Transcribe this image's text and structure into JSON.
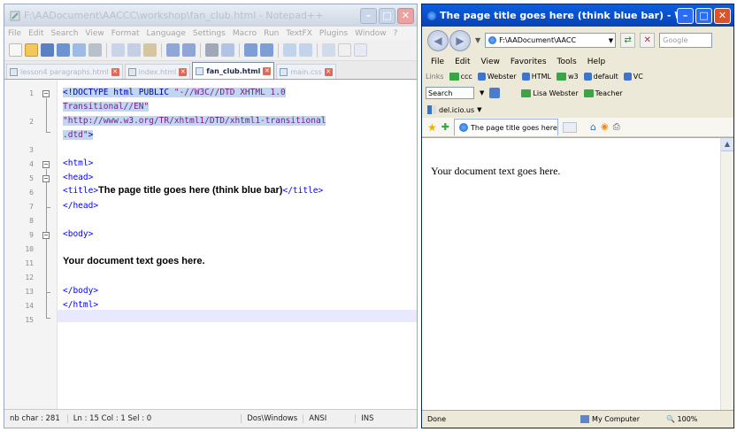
{
  "notepad": {
    "title": "F:\\AADocument\\AACCC\\workshop\\fan_club.html - Notepad++",
    "menu": [
      "File",
      "Edit",
      "Search",
      "View",
      "Format",
      "Language",
      "Settings",
      "Macro",
      "Run",
      "TextFX",
      "Plugins",
      "Window",
      "?"
    ],
    "tabs": [
      "lesson4 paragraphs.html",
      "index.html",
      "fan_club.html",
      "main.css"
    ],
    "active_tab": 2,
    "line_numbers": [
      "1",
      "2",
      "3",
      "4",
      "5",
      "6",
      "7",
      "8",
      "9",
      "10",
      "11",
      "12",
      "13",
      "14",
      "15"
    ],
    "code": {
      "l1a": "<!DOCTYPE html PUBLIC ",
      "l1b": "\"-//W3C//DTD XHTML 1.0",
      "l1c": "Transitional//EN\"",
      "l2a": "\"http://www.w3.org/TR/xhtml1/DTD/xhtml1-transitional",
      "l2b": ".dtd\"",
      "l2c": ">",
      "html_open": "<html>",
      "head_open": "<head>",
      "title_open": "<title>",
      "title_text": "The page title goes here (think blue bar)",
      "title_close": "</title>",
      "head_close": "</head>",
      "body_open": "<body>",
      "body_text": "Your document text goes here.",
      "body_close": "</body>",
      "html_close": "</html>"
    },
    "status": {
      "chars": "nb char : 281",
      "pos": "Ln : 15   Col : 1   Sel : 0",
      "eol": "Dos\\Windows",
      "enc": "ANSI",
      "mode": "INS"
    }
  },
  "ie": {
    "title": "The page title goes here (think blue bar) - Windows I...",
    "address": "F:\\AADocument\\AACC",
    "search_placeholder": "Google",
    "menu": [
      "File",
      "Edit",
      "View",
      "Favorites",
      "Tools",
      "Help"
    ],
    "links_label": "Links",
    "links": [
      "ccc",
      "Webster",
      "HTML",
      "w3",
      "default",
      "VC"
    ],
    "search_label": "Search",
    "search_links": [
      "Lisa Webster",
      "Teacher"
    ],
    "delicious": "del.icio.us",
    "tab_title": "The page title goes here (...",
    "doc_text": "Your document text goes here.",
    "status_left": "Done",
    "status_zone": "My Computer",
    "zoom": "100%"
  }
}
